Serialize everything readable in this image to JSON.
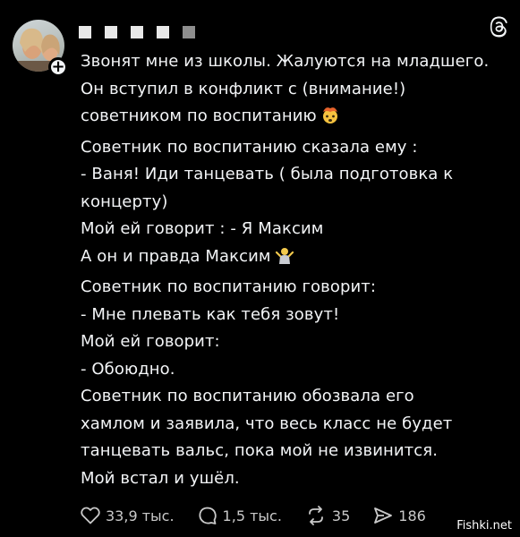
{
  "post": {
    "lines": [
      "Звонят мне из школы. Жалуются на младшего.",
      "Он вступил в конфликт с (внимание!)",
      "советником по воспитанию",
      "Советник по воспитанию сказала ему :",
      "- Ваня! Иди танцевать ( была подготовка к",
      "концерту)",
      "Мой ей говорит : - Я Максим",
      "А он и правда Максим",
      "Советник по воспитанию говорит:",
      "- Мне плевать как тебя зовут!",
      "Мой ей говорит:",
      "- Обоюдно.",
      "Советник по воспитанию обозвала его",
      "хамлом и заявила, что весь класс не будет",
      "танцевать вальс, пока мой не извинится.",
      "Мой встал и ушёл."
    ],
    "emoji_1": "exploding-head-emoji",
    "emoji_2": "shrugging-person-emoji"
  },
  "actions": {
    "likes": "33,9 тыс.",
    "replies": "1,5 тыс.",
    "reposts": "35",
    "shares": "186"
  },
  "watermark": "Fishki.net",
  "icons": [
    "threads-logo-icon",
    "plus-icon",
    "heart-icon",
    "comment-icon",
    "repost-icon",
    "share-icon"
  ]
}
